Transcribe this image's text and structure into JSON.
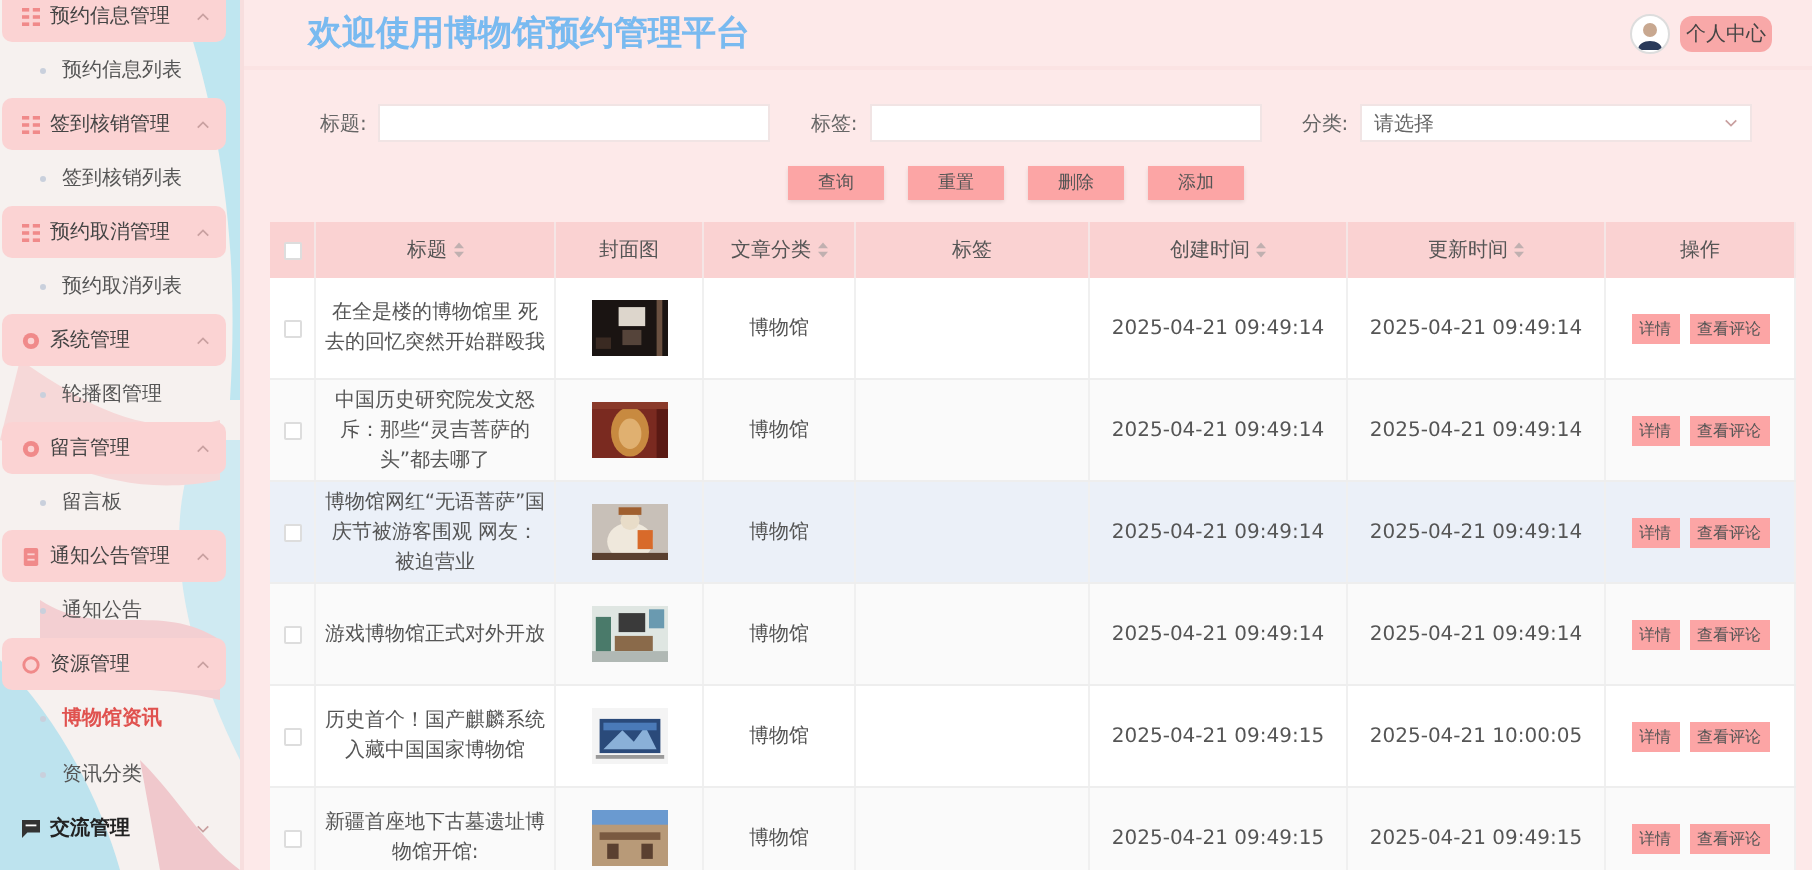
{
  "sidebar": {
    "groups": [
      {
        "label": "预约信息管理",
        "kind": "grid",
        "expanded": true,
        "children": [
          {
            "label": "预约信息列表",
            "selected": false
          }
        ]
      },
      {
        "label": "签到核销管理",
        "kind": "grid",
        "expanded": true,
        "children": [
          {
            "label": "签到核销列表",
            "selected": false
          }
        ]
      },
      {
        "label": "预约取消管理",
        "kind": "grid",
        "expanded": true,
        "children": [
          {
            "label": "预约取消列表",
            "selected": false
          }
        ]
      },
      {
        "label": "系统管理",
        "kind": "circle",
        "expanded": true,
        "children": [
          {
            "label": "轮播图管理",
            "selected": false
          }
        ]
      },
      {
        "label": "留言管理",
        "kind": "circle",
        "expanded": true,
        "children": [
          {
            "label": "留言板",
            "selected": false
          }
        ]
      },
      {
        "label": "通知公告管理",
        "kind": "doc",
        "expanded": true,
        "children": [
          {
            "label": "通知公告",
            "selected": false
          }
        ]
      },
      {
        "label": "资源管理",
        "kind": "ring",
        "expanded": true,
        "children": [
          {
            "label": "博物馆资讯",
            "selected": true
          },
          {
            "label": "资讯分类",
            "selected": false
          }
        ]
      },
      {
        "label": "交流管理",
        "kind": "chat",
        "expanded": false
      }
    ]
  },
  "header": {
    "title": "欢迎使用博物馆预约管理平台",
    "profile_button": "个人中心"
  },
  "search": {
    "fields": [
      {
        "label": "标题:",
        "kind": "text"
      },
      {
        "label": "标签:",
        "kind": "text"
      },
      {
        "label": "分类:",
        "kind": "select",
        "placeholder": "请选择"
      }
    ],
    "buttons": [
      "查询",
      "重置",
      "删除",
      "添加"
    ]
  },
  "table": {
    "select_all": {
      "checked": false
    },
    "columns": [
      {
        "label": "标题",
        "sortable": true
      },
      {
        "label": "封面图",
        "sortable": false
      },
      {
        "label": "文章分类",
        "sortable": true
      },
      {
        "label": "标签",
        "sortable": false
      },
      {
        "label": "创建时间",
        "sortable": true
      },
      {
        "label": "更新时间",
        "sortable": true
      },
      {
        "label": "操作",
        "sortable": false
      }
    ],
    "rows": [
      {
        "checked": false,
        "title": "在全是楼的博物馆里 死去的回忆突然开始群殴我",
        "cover": {
          "kind": "picture"
        },
        "category": "博物馆",
        "created": "2025-04-21 09:49:14",
        "updated": "2025-04-21 09:49:14",
        "actions": [
          "详情",
          "查看评论"
        ],
        "hovered": false
      },
      {
        "checked": false,
        "title": "中国历史研究院发文怒斥：那些“灵吉菩萨的头”都去哪了",
        "cover": {
          "kind": "picture"
        },
        "category": "博物馆",
        "created": "2025-04-21 09:49:14",
        "updated": "2025-04-21 09:49:14",
        "actions": [
          "详情",
          "查看评论"
        ],
        "hovered": false
      },
      {
        "checked": false,
        "title": "博物馆网红“无语菩萨”国庆节被游客围观 网友：被迫营业",
        "cover": {
          "kind": "picture"
        },
        "category": "博物馆",
        "created": "2025-04-21 09:49:14",
        "updated": "2025-04-21 09:49:14",
        "actions": [
          "详情",
          "查看评论"
        ],
        "hovered": true
      },
      {
        "checked": false,
        "title": "游戏博物馆正式对外开放",
        "cover": {
          "kind": "picture"
        },
        "category": "博物馆",
        "created": "2025-04-21 09:49:14",
        "updated": "2025-04-21 09:49:14",
        "actions": [
          "详情",
          "查看评论"
        ],
        "hovered": false
      },
      {
        "checked": false,
        "title": "历史首个！国产麒麟系统入藏中国国家博物馆",
        "cover": {
          "kind": "picture"
        },
        "category": "博物馆",
        "created": "2025-04-21 09:49:15",
        "updated": "2025-04-21 10:00:05",
        "actions": [
          "详情",
          "查看评论"
        ],
        "hovered": false
      },
      {
        "checked": false,
        "title": "新疆首座地下古墓遗址博物馆开馆:",
        "cover": {
          "kind": "picture"
        },
        "category": "博物馆",
        "created": "2025-04-21 09:49:15",
        "updated": "2025-04-21 09:49:15",
        "actions": [
          "详情",
          "查看评论"
        ],
        "hovered": false
      }
    ]
  }
}
